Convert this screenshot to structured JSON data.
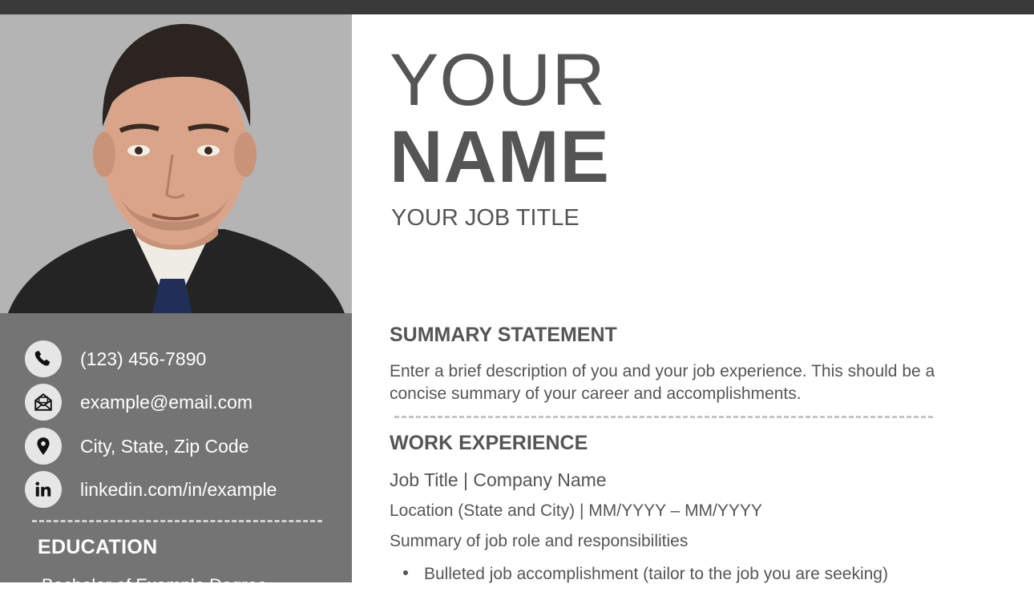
{
  "header": {
    "name_first": "YOUR",
    "name_last": "NAME",
    "job_title": "YOUR JOB TITLE"
  },
  "sidebar": {
    "contacts": [
      {
        "icon": "phone-icon",
        "text": "(123) 456-7890"
      },
      {
        "icon": "email-icon",
        "text": "example@email.com"
      },
      {
        "icon": "location-pin-icon",
        "text": "City, State, Zip Code"
      },
      {
        "icon": "linkedin-icon",
        "text": "linkedin.com/in/example"
      }
    ],
    "education_heading": "EDUCATION",
    "education_item": "Bachelor of Example Degree"
  },
  "summary": {
    "heading": "SUMMARY STATEMENT",
    "text": "Enter a brief description of you and your job experience. This should be a concise summary of your career and accomplishments."
  },
  "work": {
    "heading": "WORK EXPERIENCE",
    "job_line": "Job Title | Company Name",
    "location_line": "Location (State and City) | MM/YYYY – MM/YYYY",
    "summary_line": "Summary of job role and responsibilities",
    "bullet": "Bulleted job accomplishment (tailor to the job you are seeking)"
  },
  "colors": {
    "topbar": "#3a3a3a",
    "sidebar": "#747474",
    "photo_bg": "#b4b4b4",
    "text_dark": "#555555",
    "icon_circle": "#e6e6e6"
  }
}
